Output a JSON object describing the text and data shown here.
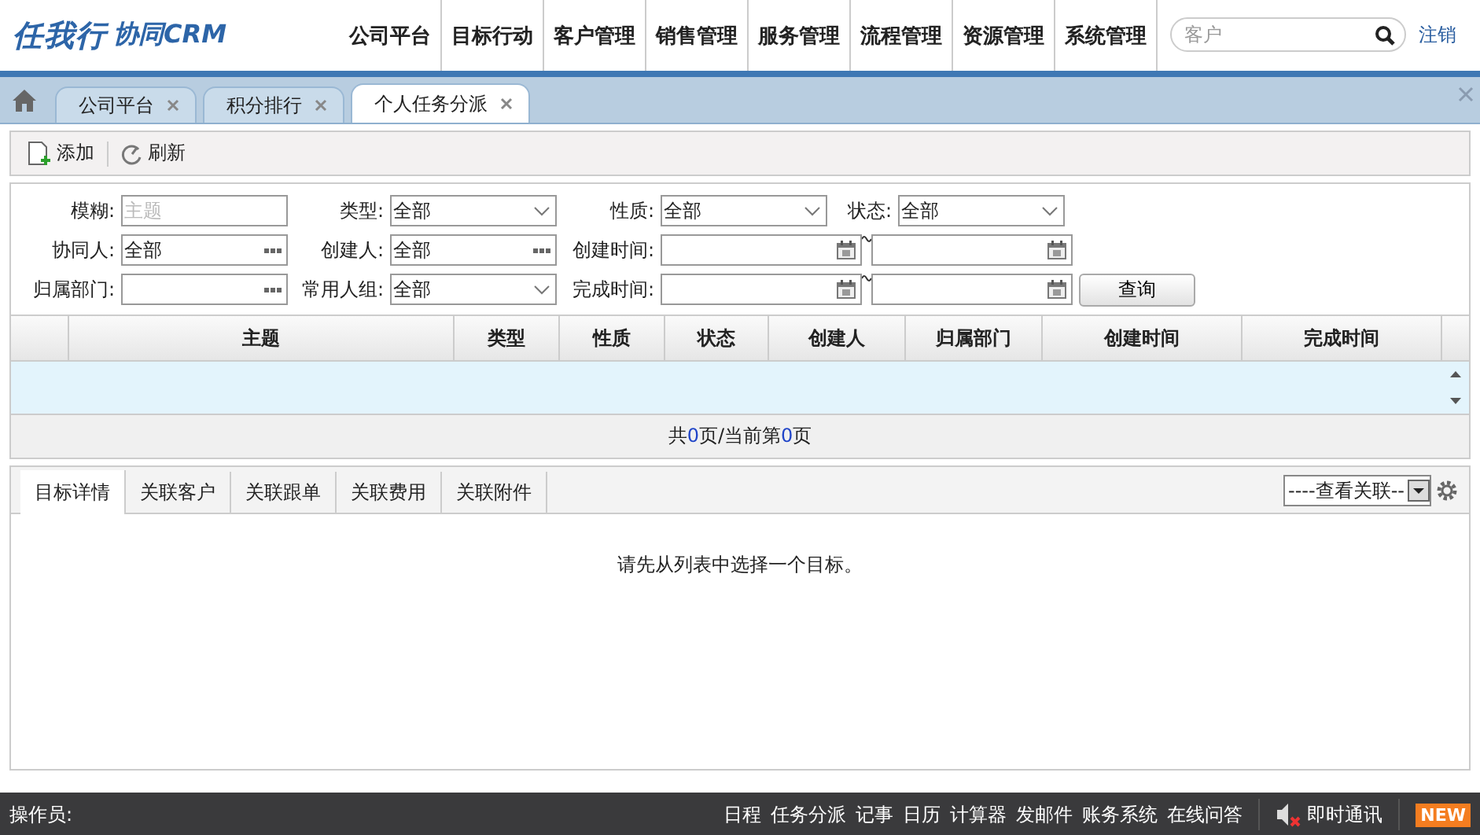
{
  "header": {
    "brand": "任我行",
    "product": "协同CRM",
    "nav": [
      {
        "label": "公司平台"
      },
      {
        "label": "目标行动"
      },
      {
        "label": "客户管理"
      },
      {
        "label": "销售管理"
      },
      {
        "label": "服务管理"
      },
      {
        "label": "流程管理"
      },
      {
        "label": "资源管理"
      },
      {
        "label": "系统管理"
      }
    ],
    "search": {
      "placeholder": "客户"
    },
    "logout": "注销"
  },
  "tabs": [
    {
      "label": "公司平台",
      "selected": false
    },
    {
      "label": "积分排行",
      "selected": false
    },
    {
      "label": "个人任务分派",
      "selected": true
    }
  ],
  "toolbar": [
    {
      "label": "添加",
      "kind": "add"
    },
    {
      "label": "刷新",
      "kind": "refresh"
    }
  ],
  "filters": [
    [
      {
        "label": "模糊:",
        "kind": "text",
        "placeholder": "主题"
      },
      {
        "label": "类型:",
        "kind": "select",
        "value": "全部"
      },
      {
        "label": "性质:",
        "kind": "select",
        "value": "全部"
      },
      {
        "label": "状态:",
        "kind": "select",
        "value": "全部"
      }
    ],
    [
      {
        "label": "协同人:",
        "kind": "picker",
        "value": "全部"
      },
      {
        "label": "创建人:",
        "kind": "picker",
        "value": "全部"
      },
      {
        "label": "创建时间:",
        "kind": "date_range"
      }
    ],
    [
      {
        "label": "归属部门:",
        "kind": "picker"
      },
      {
        "label": "常用人组:",
        "kind": "select",
        "value": "全部"
      },
      {
        "label": "完成时间:",
        "kind": "date_range"
      }
    ]
  ],
  "query_button": "查询",
  "table": {
    "columns": [
      "主题",
      "类型",
      "性质",
      "状态",
      "创建人",
      "归属部门",
      "创建时间",
      "完成时间"
    ]
  },
  "pager": [
    {
      "text": "共",
      "kind": "plain"
    },
    {
      "text": "0",
      "kind": "number"
    },
    {
      "text": "页/当前第",
      "kind": "plain"
    },
    {
      "text": "0",
      "kind": "number"
    },
    {
      "text": "页",
      "kind": "plain"
    }
  ],
  "detail": {
    "tabs": [
      {
        "label": "目标详情",
        "selected": true
      },
      {
        "label": "关联客户",
        "selected": false
      },
      {
        "label": "关联跟单",
        "selected": false
      },
      {
        "label": "关联费用",
        "selected": false
      },
      {
        "label": "关联附件",
        "selected": false
      }
    ],
    "related_select": "----查看关联--",
    "message": "请先从列表中选择一个目标。"
  },
  "footer": {
    "operator": "操作员:",
    "links": [
      "日程",
      "任务分派",
      "记事",
      "日历",
      "计算器",
      "发邮件",
      "账务系统",
      "在线问答"
    ],
    "chat": "即时通讯",
    "badge": "NEW"
  }
}
